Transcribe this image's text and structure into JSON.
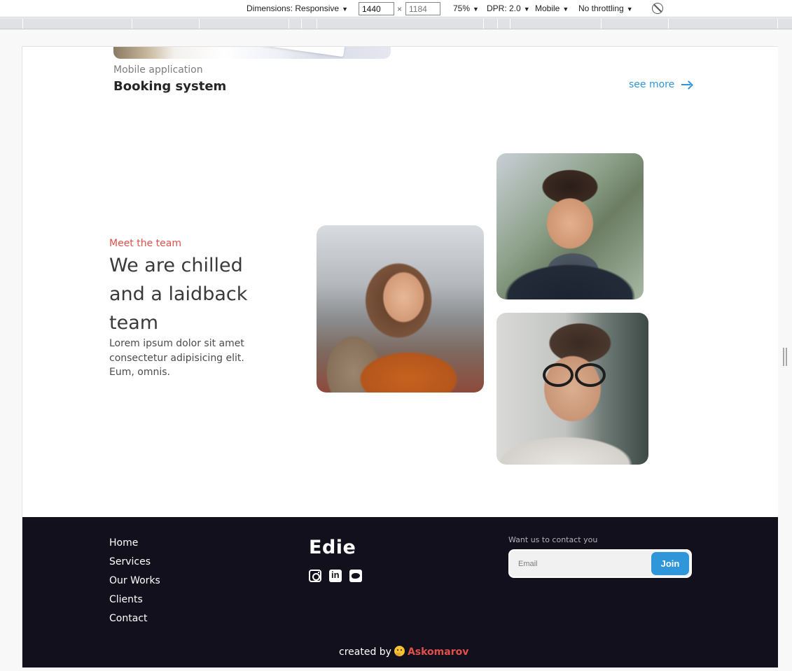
{
  "devtools": {
    "dimensions_label": "Dimensions: Responsive",
    "width_value": "1440",
    "height_placeholder": "1184",
    "times": "×",
    "zoom": "75%",
    "dpr": "DPR: 2.0",
    "device": "Mobile",
    "throttling": "No throttling",
    "caret": "▼"
  },
  "project": {
    "subtitle": "Mobile application",
    "title": "Booking system",
    "see_more": "see more"
  },
  "team": {
    "eyebrow": "Meet the team",
    "heading": "We are chilled and a laidback team",
    "text": "Lorem ipsum dolor sit amet consectetur adipisicing elit. Eum, omnis."
  },
  "footer": {
    "nav": [
      "Home",
      "Services",
      "Our Works",
      "Clients",
      "Contact"
    ],
    "brand": "Edie",
    "socials": [
      "instagram-icon",
      "linkedin-icon",
      "twitter-icon"
    ],
    "contact_label": "Want us to contact you",
    "email_placeholder": "Email",
    "join_label": "Join",
    "credits_prefix": "created by",
    "credits_author": "Askomarov"
  },
  "colors": {
    "accent_red": "#e0504b",
    "accent_blue": "#2f96d9",
    "footer_bg": "#13101d"
  }
}
